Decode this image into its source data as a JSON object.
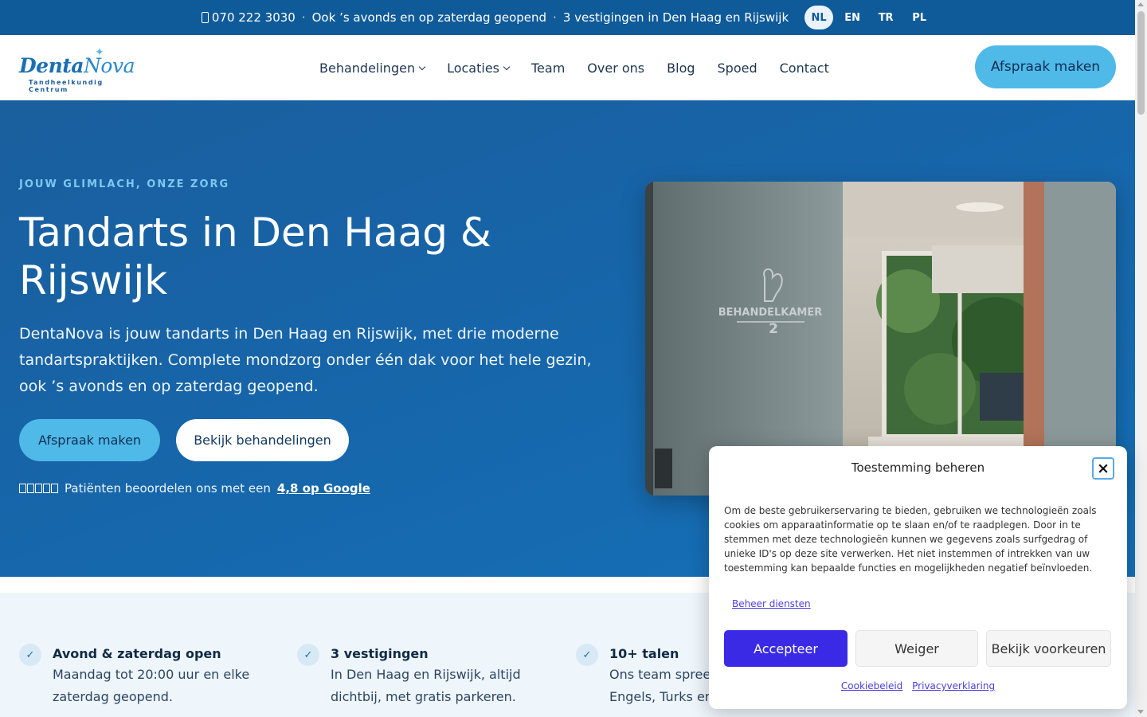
{
  "topbar": {
    "phone": "070 222 3030",
    "hours": "Ook ’s avonds en op zaterdag geopend",
    "locations": "3 vestigingen in Den Haag en Rijswijk",
    "separator": "·",
    "languages": [
      "NL",
      "EN",
      "TR",
      "PL"
    ],
    "active_language": "NL"
  },
  "header": {
    "logo_brand_1": "Denta",
    "logo_brand_2": "Nova",
    "logo_tagline": "Tandheelkundig Centrum",
    "nav": [
      {
        "label": "Behandelingen",
        "dropdown": true
      },
      {
        "label": "Locaties",
        "dropdown": true
      },
      {
        "label": "Team",
        "dropdown": false
      },
      {
        "label": "Over ons",
        "dropdown": false
      },
      {
        "label": "Blog",
        "dropdown": false
      },
      {
        "label": "Spoed",
        "dropdown": false
      },
      {
        "label": "Contact",
        "dropdown": false
      }
    ],
    "cta": "Afspraak maken"
  },
  "hero": {
    "eyebrow": "JOUW GLIMLACH, ONZE ZORG",
    "title": "Tandarts in Den Haag & Rijswijk",
    "lead": "DentaNova is jouw tandarts in Den Haag en Rijswijk, met drie moderne tandartspraktijken. Complete mondzorg onder één dak voor het hele gezin, ook ’s avonds en op zaterdag geopend.",
    "primary_button": "Afspraak maken",
    "secondary_button": "Bekijk behandelingen",
    "rating_text": "Patiënten beoordelen ons met een",
    "rating_link": "4,8 op Google",
    "photo_sign_1": "BEHANDELKAMER",
    "photo_sign_2": "2"
  },
  "features": [
    {
      "title": "Avond & zaterdag open",
      "line1": "Maandag tot 20:00 uur en elke",
      "line2": "zaterdag geopend."
    },
    {
      "title": "3 vestigingen",
      "line1": "In Den Haag en Rijswijk, altijd",
      "line2": "dichtbij, met gratis parkeren."
    },
    {
      "title": "10+ talen",
      "line1": "Ons team spreek",
      "line2": "Engels, Turks en"
    }
  ],
  "cookie": {
    "title": "Toestemming beheren",
    "body": "Om de beste gebruikerservaring te bieden, gebruiken we technologieën zoals cookies om apparaatinformatie op te slaan en/of te raadplegen. Door in te stemmen met deze technologieën kunnen we gegevens zoals surfgedrag of unieke ID's op deze site verwerken. Het niet instemmen of intrekken van uw toestemming kan bepaalde functies en mogelijkheden negatief beïnvloeden.",
    "manage": "Beheer diensten",
    "accept": "Accepteer",
    "deny": "Weiger",
    "preferences": "Bekijk voorkeuren",
    "policy_link": "Cookiebeleid",
    "privacy_link": "Privacyverklaring",
    "close_glyph": "×"
  },
  "colors": {
    "topbar": "#0f5a99",
    "accent": "#4fb9e8",
    "accept": "#3a2ae6"
  }
}
